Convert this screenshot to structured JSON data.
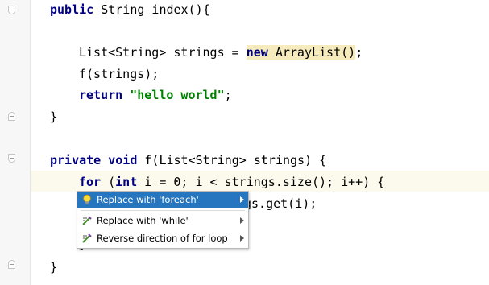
{
  "editor": {
    "current_line_color": "#fcfaed",
    "lines": {
      "l1": {
        "kw1": "public",
        "rest": " String index(){"
      },
      "l2": {
        "a": "List<String> strings = ",
        "kw_new": "new",
        "b": " ArrayList()",
        "c": ";"
      },
      "l3": {
        "text": "f(strings);"
      },
      "l4": {
        "kw": "return",
        "sp": " ",
        "str": "\"hello world\"",
        "end": ";"
      },
      "l5": {
        "text": "}"
      },
      "l6": {
        "kw1": "private",
        "sp1": " ",
        "kw2": "void",
        "rest": " f(List<String> strings) {"
      },
      "l7": {
        "kw1": "for",
        "a": " (",
        "kw2": "int",
        "b": " i = 0; i < strings.size(); i++) {"
      },
      "l8": {
        "text": "gs.get(i);"
      },
      "l9": {
        "text": "}"
      },
      "l10": {
        "text": "}"
      }
    }
  },
  "intention_popup": {
    "items": [
      {
        "label": "Replace with 'foreach'",
        "icon": "lightbulb-icon",
        "selected": true,
        "has_submenu": true
      },
      {
        "label": "Replace with 'while'",
        "icon": "quickfix-wand-icon",
        "selected": false,
        "has_submenu": true
      },
      {
        "label": "Reverse direction of for loop",
        "icon": "quickfix-wand-icon",
        "selected": false,
        "has_submenu": true
      }
    ],
    "selection_color": "#2675bf"
  },
  "colors": {
    "keyword": "#000080",
    "string": "#008000",
    "new_highlight": "#f6ebbc",
    "gutter": "#f7f7f7"
  }
}
